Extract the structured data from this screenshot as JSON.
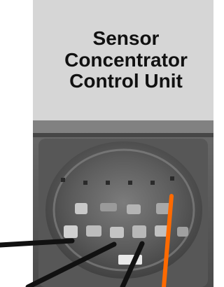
{
  "label": {
    "title": "Sensor\nConcentrator\nControl Unit",
    "background_color": "#d6d6d6"
  },
  "photo": {
    "subject": "connector-photo"
  },
  "leader_lines": {
    "black_color": "#111111",
    "orange_color": "#ff6a00"
  }
}
